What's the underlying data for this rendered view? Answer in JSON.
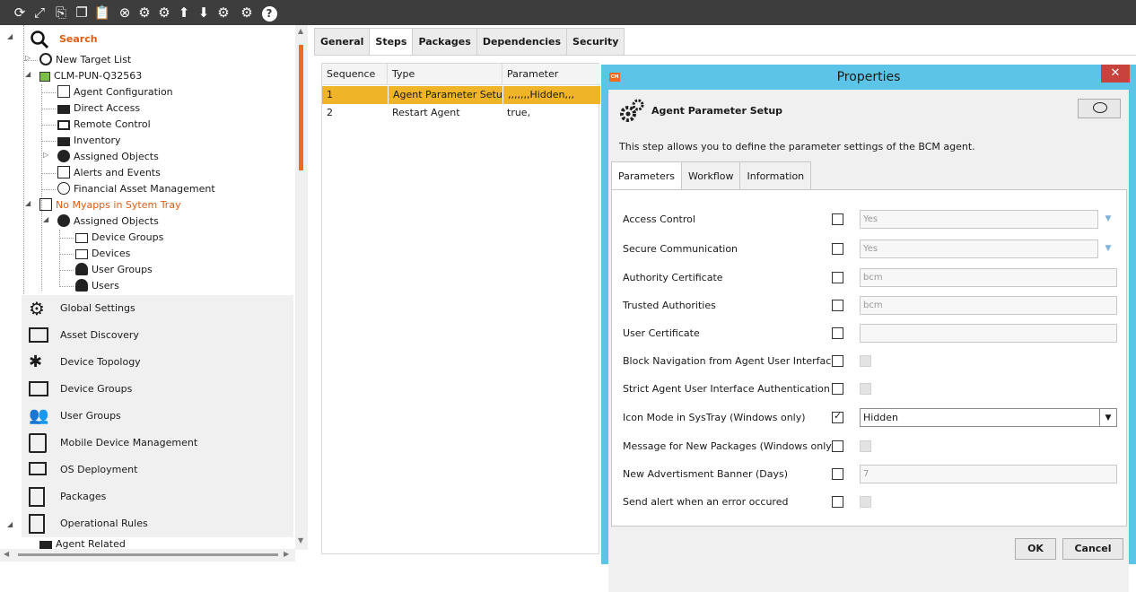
{
  "toolbar": {
    "icons": [
      "refresh-icon",
      "expand-icon",
      "copy-icon",
      "duplicate-icon",
      "paste-icon",
      "cancel-icon",
      "add-settings-icon",
      "add-settings-icon",
      "move-up-icon",
      "move-down-icon",
      "properties-icon",
      "settings-icon",
      "help-icon"
    ]
  },
  "tree": {
    "search_label": "Search",
    "items": [
      "New Target List",
      "CLM-PUN-Q32563",
      "Agent Configuration",
      "Direct Access",
      "Remote Control",
      "Inventory",
      "Assigned Objects",
      "Alerts and Events",
      "Financial Asset Management",
      "No Myapps in Sytem Tray",
      "Assigned Objects",
      "Device Groups",
      "Devices",
      "User Groups",
      "Users"
    ],
    "highlight_color": "#e05c10"
  },
  "nav": {
    "items": [
      "Global Settings",
      "Asset Discovery",
      "Device Topology",
      "Device Groups",
      "User Groups",
      "Mobile Device Management",
      "OS Deployment",
      "Packages",
      "Operational Rules",
      "Agent Related"
    ]
  },
  "main_tabs": [
    "General",
    "Steps",
    "Packages",
    "Dependencies",
    "Security"
  ],
  "active_main_tab": "Steps",
  "steps_grid": {
    "columns": [
      "Sequence",
      "Type",
      "Parameter"
    ],
    "rows": [
      {
        "seq": "1",
        "type": "Agent Parameter Setup",
        "param": ",,,,,,,Hidden,,,"
      },
      {
        "seq": "2",
        "type": "Restart Agent",
        "param": "true,"
      }
    ],
    "selected_color": "#f0b429"
  },
  "dialog": {
    "title": "Properties",
    "logo_text": "CM",
    "close_label": "x",
    "header_title": "Agent Parameter Setup",
    "description": "This step allows you to define the parameter settings of the BCM agent.",
    "tabs": [
      "Parameters",
      "Workflow",
      "Information"
    ],
    "params": [
      {
        "label": "Access Control",
        "value": "Yes"
      },
      {
        "label": "Secure Communication",
        "value": "Yes"
      },
      {
        "label": "Authority Certificate",
        "value": "bcm"
      },
      {
        "label": "Trusted Authorities",
        "value": "bcm"
      },
      {
        "label": "User Certificate",
        "value": ""
      },
      {
        "label": "Block Navigation from Agent User Interface",
        "value": ""
      },
      {
        "label": "Strict Agent User Interface Authentication",
        "value": ""
      },
      {
        "label": "Icon Mode in SysTray (Windows only)",
        "value": "Hidden"
      },
      {
        "label": "Message for New Packages (Windows only)",
        "value": ""
      },
      {
        "label": "New Advertisment Banner (Days)",
        "value": "7"
      },
      {
        "label": "Send alert when an error occured",
        "value": ""
      }
    ],
    "icon_mode_checked": true,
    "ok_label": "OK",
    "cancel_label": "Cancel",
    "accent": "#5bc4e7"
  }
}
